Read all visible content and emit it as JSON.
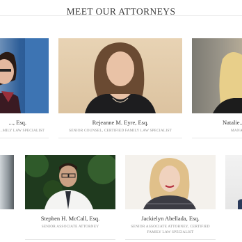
{
  "section": {
    "title": "MEET OUR ATTORNEYS"
  },
  "attorneys": [
    {
      "name": "..., Esq.",
      "role": "...MILY LAW SPECIALIST"
    },
    {
      "name": "Rejeanne M. Eyre, Esq.",
      "role": "SENIOR COUNSEL, CERTIFIED FAMILY LAW SPECIALIST"
    },
    {
      "name": "Natalie...",
      "role": "MANA..."
    },
    {
      "name": "Stephen H. McCall, Esq.",
      "role": "SENIOR ASSOCIATE ATTORNEY"
    },
    {
      "name": "Jackielyn Abellada, Esq.",
      "role_line1": "SENIOR ASSOCIATE ATTORNEY, CERTIFIED",
      "role_line2": "FAMILY LAW SPECIALIST"
    }
  ]
}
